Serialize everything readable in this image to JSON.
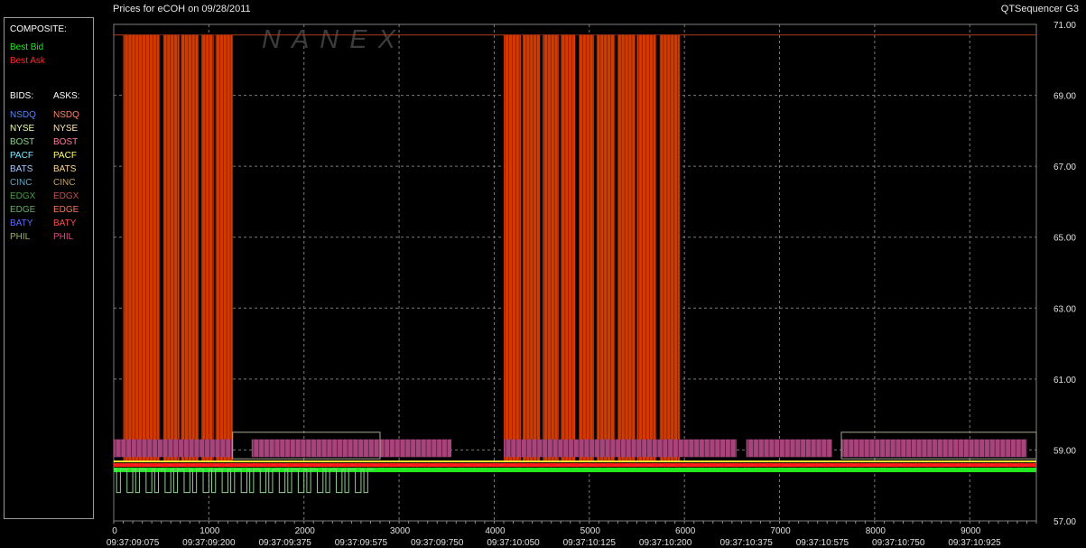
{
  "header": {
    "title": "Prices for  eCOH  on  09/28/2011",
    "brand": "QTSequencer G3",
    "watermark": "NANEX"
  },
  "legend": {
    "composite_label": "COMPOSITE:",
    "composite": [
      {
        "label": "Best Bid",
        "color": "#22e822"
      },
      {
        "label": "Best Ask",
        "color": "#ff2a2a"
      }
    ],
    "bids_label": "BIDS:",
    "asks_label": "ASKS:",
    "bids": [
      {
        "label": "NSDQ",
        "color": "#4f86ff"
      },
      {
        "label": "NYSE",
        "color": "#e8ffb0"
      },
      {
        "label": "BOST",
        "color": "#8fd08f"
      },
      {
        "label": "PACF",
        "color": "#7fe8ff"
      },
      {
        "label": "BATS",
        "color": "#a8c8ff"
      },
      {
        "label": "CINC",
        "color": "#5aa8c8"
      },
      {
        "label": "EDGX",
        "color": "#3fa03f"
      },
      {
        "label": "EDGE",
        "color": "#66b066"
      },
      {
        "label": "BATY",
        "color": "#5a6cff"
      },
      {
        "label": "PHIL",
        "color": "#98b070"
      }
    ],
    "asks": [
      {
        "label": "NSDQ",
        "color": "#ff8060"
      },
      {
        "label": "NYSE",
        "color": "#ffe8b8"
      },
      {
        "label": "BOST",
        "color": "#ff7aa0"
      },
      {
        "label": "PACF",
        "color": "#ffff70"
      },
      {
        "label": "BATS",
        "color": "#ffd890"
      },
      {
        "label": "CINC",
        "color": "#c8a060"
      },
      {
        "label": "EDGX",
        "color": "#c05050"
      },
      {
        "label": "EDGE",
        "color": "#ff7850"
      },
      {
        "label": "BATY",
        "color": "#ff5050"
      },
      {
        "label": "PHIL",
        "color": "#d85080"
      }
    ]
  },
  "chart_data": {
    "type": "line",
    "x_range": [
      0,
      9700
    ],
    "ylim": [
      57,
      71
    ],
    "y_ticks": [
      "57.00",
      "59.00",
      "61.00",
      "63.00",
      "65.00",
      "67.00",
      "69.00",
      "71.00"
    ],
    "x_ticks": [
      {
        "value": 0,
        "label": "0"
      },
      {
        "value": 1000,
        "label": "1000"
      },
      {
        "value": 2000,
        "label": "2000"
      },
      {
        "value": 3000,
        "label": "3000"
      },
      {
        "value": 4000,
        "label": "4000"
      },
      {
        "value": 5000,
        "label": "5000"
      },
      {
        "value": 6000,
        "label": "6000"
      },
      {
        "value": 7000,
        "label": "7000"
      },
      {
        "value": 8000,
        "label": "8000"
      },
      {
        "value": 9000,
        "label": "9000"
      }
    ],
    "time_labels": [
      {
        "value": 200,
        "label": "09:37:09:075"
      },
      {
        "value": 1000,
        "label": "09:37:09:200"
      },
      {
        "value": 1800,
        "label": "09:37:09:375"
      },
      {
        "value": 2600,
        "label": "09:37:09:575"
      },
      {
        "value": 3400,
        "label": "09:37:09:750"
      },
      {
        "value": 4200,
        "label": "09:37:10:050"
      },
      {
        "value": 5000,
        "label": "09:37:10:125"
      },
      {
        "value": 5800,
        "label": "09:37:10:200"
      },
      {
        "value": 6650,
        "label": "09:37:10:375"
      },
      {
        "value": 7450,
        "label": "09:37:10:575"
      },
      {
        "value": 8250,
        "label": "09:37:10:750"
      },
      {
        "value": 9050,
        "label": "09:37:10:925"
      }
    ],
    "grid": true,
    "levels": {
      "top_ask": 70.7,
      "baseline": 58.7,
      "best_ask": 58.6,
      "best_bid": 58.45,
      "purple_low": 58.8,
      "purple_high": 59.3,
      "bid_low": 57.8
    },
    "series": [
      {
        "label": "Best Ask spikes",
        "color": "#d23a00",
        "kind": "regions",
        "segments": [
          [
            100,
            1250
          ],
          [
            4100,
            5950
          ]
        ],
        "gaps": [
          [
            480,
            520
          ],
          [
            690,
            710
          ],
          [
            890,
            920
          ],
          [
            1050,
            1070
          ],
          [
            4280,
            4300
          ],
          [
            4480,
            4510
          ],
          [
            4680,
            4700
          ],
          [
            4850,
            4890
          ],
          [
            5050,
            5080
          ],
          [
            5270,
            5300
          ],
          [
            5480,
            5500
          ],
          [
            5700,
            5740
          ]
        ]
      },
      {
        "label": "PHIL ask band",
        "color": "#a8447a",
        "kind": "band",
        "segments": [
          [
            0,
            1250
          ],
          [
            1450,
            3550
          ],
          [
            4100,
            6550
          ],
          [
            6650,
            7550
          ],
          [
            7650,
            9600
          ]
        ]
      },
      {
        "label": "BOST bid",
        "color": "#8fd08f",
        "kind": "dips",
        "segments": [
          [
            0,
            2700
          ]
        ]
      }
    ]
  }
}
